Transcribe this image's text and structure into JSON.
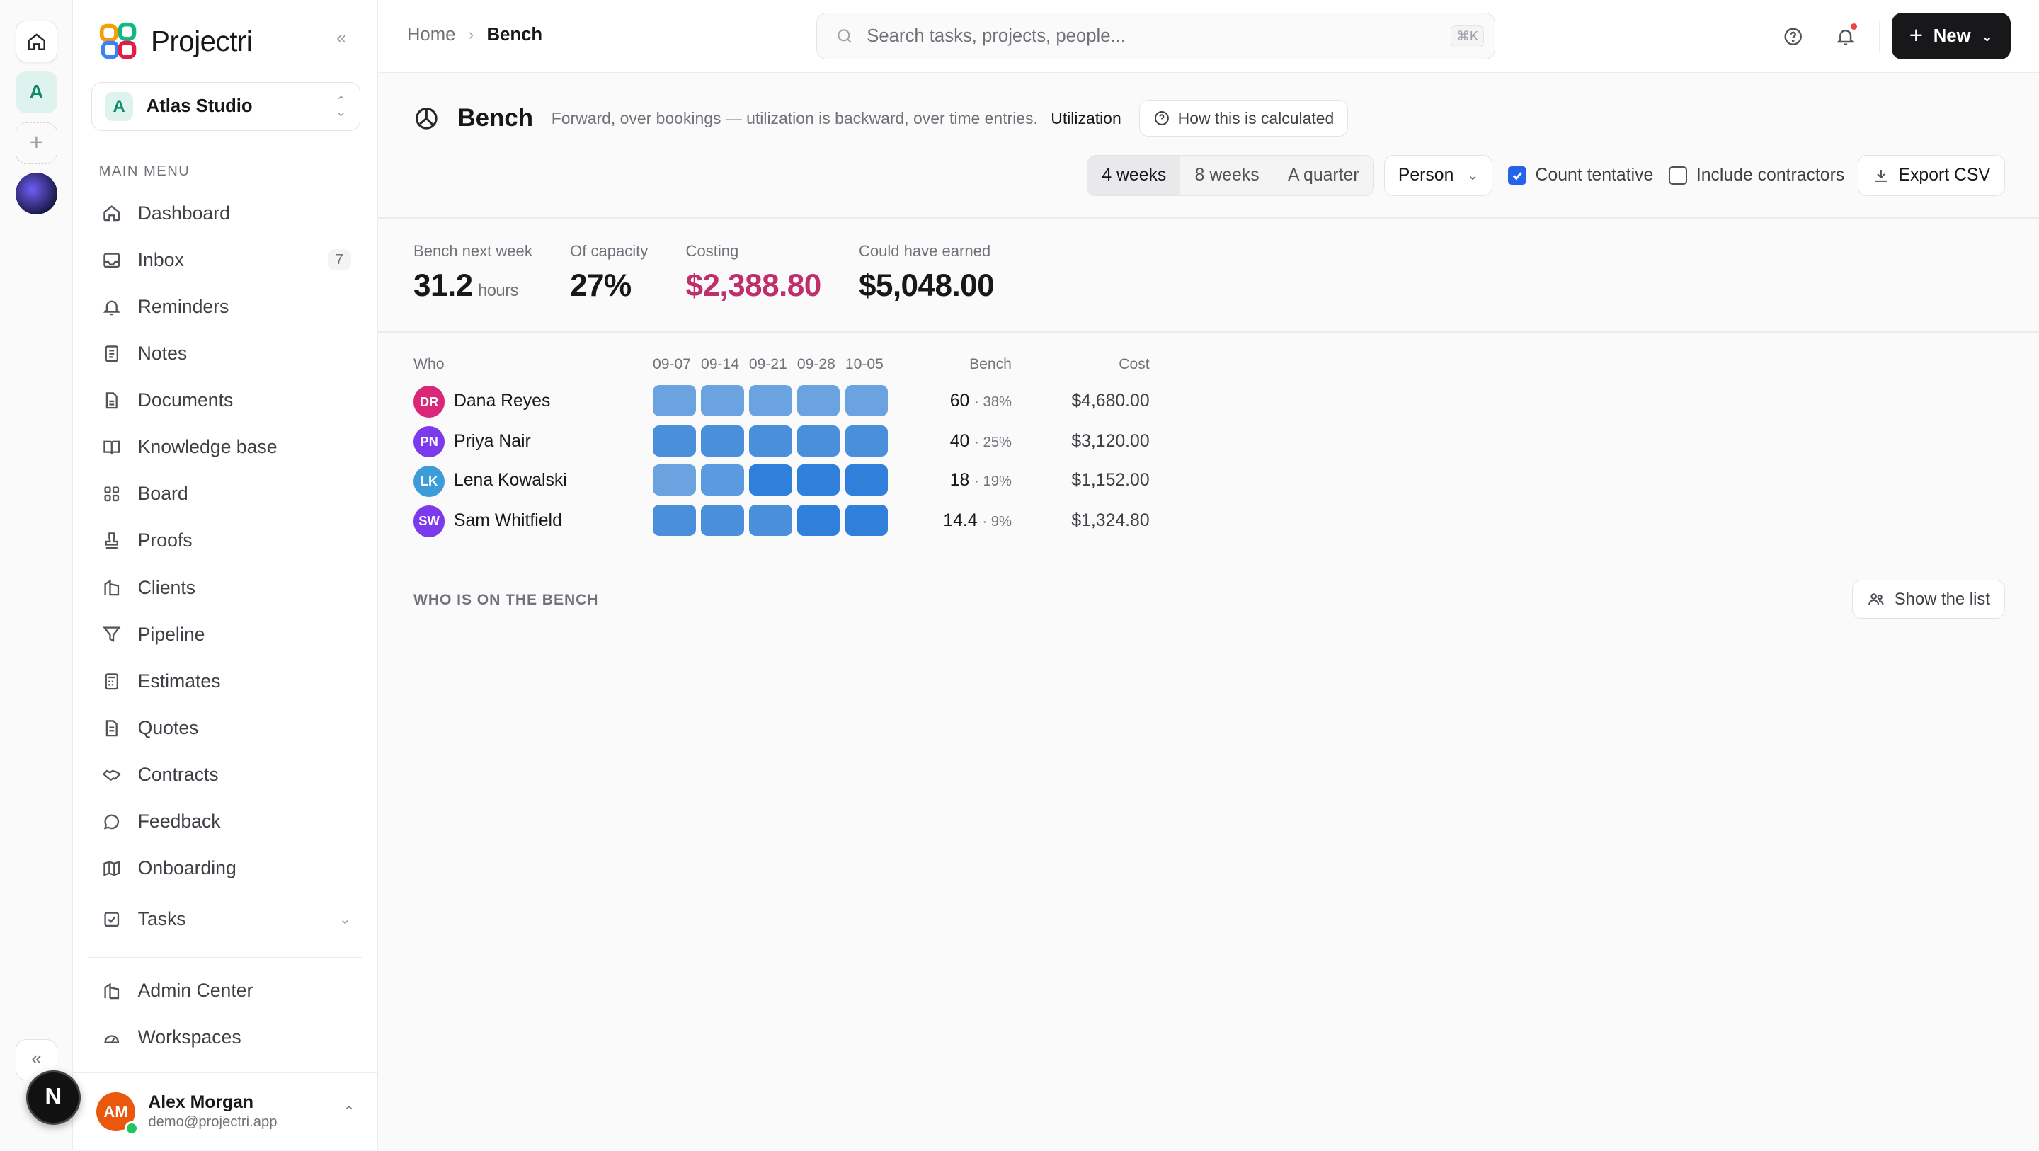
{
  "app": {
    "name": "Projectri"
  },
  "workspace": {
    "initial": "A",
    "name": "Atlas Studio"
  },
  "sidebar": {
    "menu_label": "MAIN MENU",
    "items": [
      {
        "label": "Dashboard",
        "icon": "home-icon"
      },
      {
        "label": "Inbox",
        "icon": "inbox-icon",
        "count": "7"
      },
      {
        "label": "Reminders",
        "icon": "bell-icon"
      },
      {
        "label": "Notes",
        "icon": "note-icon"
      },
      {
        "label": "Documents",
        "icon": "document-icon"
      },
      {
        "label": "Knowledge base",
        "icon": "book-icon"
      },
      {
        "label": "Board",
        "icon": "grid-icon"
      },
      {
        "label": "Proofs",
        "icon": "stamp-icon"
      },
      {
        "label": "Clients",
        "icon": "building-icon"
      },
      {
        "label": "Pipeline",
        "icon": "funnel-icon"
      },
      {
        "label": "Estimates",
        "icon": "calculator-icon"
      },
      {
        "label": "Quotes",
        "icon": "quote-doc-icon"
      },
      {
        "label": "Contracts",
        "icon": "handshake-icon"
      },
      {
        "label": "Feedback",
        "icon": "chat-icon"
      },
      {
        "label": "Onboarding",
        "icon": "map-icon"
      }
    ],
    "tasks_label": "Tasks",
    "admin_items": [
      {
        "label": "Admin Center",
        "icon": "building-icon"
      },
      {
        "label": "Workspaces",
        "icon": "gauge-icon"
      }
    ]
  },
  "user": {
    "initials": "AM",
    "name": "Alex Morgan",
    "email": "demo@projectri.app"
  },
  "rail": {
    "workspace_initial": "A",
    "n_label": "N"
  },
  "header": {
    "breadcrumb": {
      "home": "Home",
      "current": "Bench"
    },
    "search_placeholder": "Search tasks, projects, people...",
    "search_kbd": "⌘K",
    "new_label": "New"
  },
  "page": {
    "title": "Bench",
    "subtitle": "Forward, over bookings — utilization is backward, over time entries.",
    "subtitle_link": "Utilization",
    "how_button": "How this is calculated"
  },
  "controls": {
    "ranges": [
      "4 weeks",
      "8 weeks",
      "A quarter"
    ],
    "active_range": "4 weeks",
    "group_by": "Person",
    "count_tentative": {
      "label": "Count tentative",
      "checked": true
    },
    "include_contractors": {
      "label": "Include contractors",
      "checked": false
    },
    "export_label": "Export CSV"
  },
  "stats": [
    {
      "label": "Bench next week",
      "value": "31.2",
      "unit": "hours"
    },
    {
      "label": "Of capacity",
      "value": "27%"
    },
    {
      "label": "Costing",
      "value": "$2,388.80",
      "color": "#be2f6b"
    },
    {
      "label": "Could have earned",
      "value": "$5,048.00"
    }
  ],
  "table": {
    "headers": {
      "who": "Who",
      "bench": "Bench",
      "cost": "Cost"
    },
    "weeks": [
      "09-07",
      "09-14",
      "09-21",
      "09-28",
      "10-05"
    ],
    "rows": [
      {
        "initials": "DR",
        "name": "Dana Reyes",
        "avatar_color": "#db2777",
        "bench": "60",
        "pct": "· 38%",
        "cost": "$4,680.00",
        "cells": [
          "#6aa3e0",
          "#6aa3e0",
          "#6aa3e0",
          "#6aa3e0",
          "#6aa3e0"
        ]
      },
      {
        "initials": "PN",
        "name": "Priya Nair",
        "avatar_color": "#7c3aed",
        "bench": "40",
        "pct": "· 25%",
        "cost": "$3,120.00",
        "cells": [
          "#4a8fdc",
          "#4a8fdc",
          "#4a8fdc",
          "#4a8fdc",
          "#4a8fdc"
        ]
      },
      {
        "initials": "LK",
        "name": "Lena Kowalski",
        "avatar_color": "#3b9cd8",
        "bench": "18",
        "pct": "· 19%",
        "cost": "$1,152.00",
        "cells": [
          "#6aa3e0",
          "#5b9ade",
          "#2f7fdb",
          "#2f7fdb",
          "#2f7fdb"
        ]
      },
      {
        "initials": "SW",
        "name": "Sam Whitfield",
        "avatar_color": "#7c3aed",
        "bench": "14.4",
        "pct": "· 9%",
        "cost": "$1,324.80",
        "cells": [
          "#4a8fdc",
          "#4a8fdc",
          "#4a8fdc",
          "#2f7fdb",
          "#2f7fdb"
        ]
      }
    ]
  },
  "bench_section": {
    "label": "WHO IS ON THE BENCH",
    "show_button": "Show the list"
  }
}
